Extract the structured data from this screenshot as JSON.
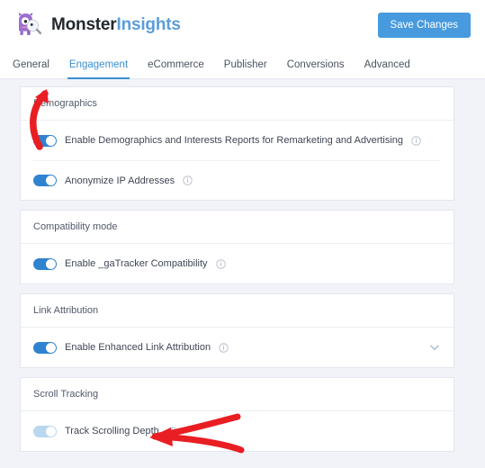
{
  "header": {
    "brand_primary": "Monster",
    "brand_secondary": "Insights",
    "logo_icon": "monster-mascot-logo",
    "save_label": "Save Changes",
    "accent_color": "#479ade"
  },
  "tabs": [
    {
      "label": "General",
      "active": false
    },
    {
      "label": "Engagement",
      "active": true
    },
    {
      "label": "eCommerce",
      "active": false
    },
    {
      "label": "Publisher",
      "active": false
    },
    {
      "label": "Conversions",
      "active": false
    },
    {
      "label": "Advanced",
      "active": false
    }
  ],
  "sections": [
    {
      "title": "Demographics",
      "rows": [
        {
          "label": "Enable Demographics and Interests Reports for Remarketing and Advertising",
          "toggle_state": "on",
          "info_icon": "info-circle-icon",
          "chevron": false
        },
        {
          "label": "Anonymize IP Addresses",
          "toggle_state": "on",
          "info_icon": "info-circle-icon",
          "chevron": false
        }
      ]
    },
    {
      "title": "Compatibility mode",
      "rows": [
        {
          "label": "Enable _gaTracker Compatibility",
          "toggle_state": "on",
          "info_icon": "info-circle-icon",
          "chevron": false
        }
      ]
    },
    {
      "title": "Link Attribution",
      "rows": [
        {
          "label": "Enable Enhanced Link Attribution",
          "toggle_state": "on",
          "info_icon": "info-circle-icon",
          "chevron": true,
          "chevron_icon": "chevron-down-icon"
        }
      ]
    },
    {
      "title": "Scroll Tracking",
      "rows": [
        {
          "label": "Track Scrolling Depth",
          "toggle_state": "faded",
          "info_icon": "info-circle-icon",
          "chevron": false
        }
      ]
    }
  ],
  "annotations": {
    "color": "#e81e23",
    "items": [
      {
        "name": "arrow-pointing-to-demographics-toggle"
      },
      {
        "name": "arrow-pointing-to-track-scrolling-depth-toggle"
      }
    ]
  }
}
